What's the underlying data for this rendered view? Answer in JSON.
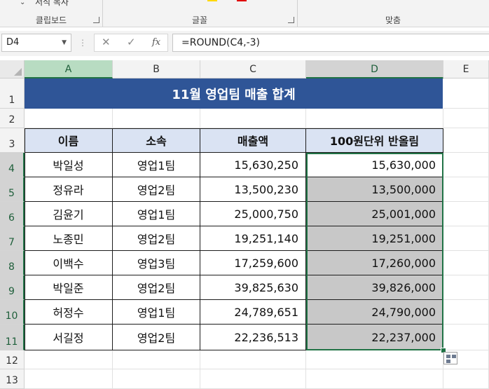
{
  "ribbon": {
    "clipboard_label": "클립보드",
    "copy_label": "서식 복사",
    "font_label": "글꼴",
    "align_label": "맞춤"
  },
  "formula_bar": {
    "name_box": "D4",
    "formula": "=ROUND(C4,-3)",
    "cancel_icon": "✕",
    "enter_icon": "✓",
    "fx_icon": "fx"
  },
  "columns": [
    "A",
    "B",
    "C",
    "D",
    "E"
  ],
  "rows": [
    "1",
    "2",
    "3",
    "4",
    "5",
    "6",
    "7",
    "8",
    "9",
    "10",
    "11",
    "12",
    "13"
  ],
  "sheet": {
    "title": "11월 영업팀 매출 합계",
    "headers": [
      "이름",
      "소속",
      "매출액",
      "100원단위 반올림"
    ],
    "data": [
      [
        "박일성",
        "영업1팀",
        "15,630,250",
        "15,630,000"
      ],
      [
        "정유라",
        "영업2팀",
        "13,500,230",
        "13,500,000"
      ],
      [
        "김윤기",
        "영업1팀",
        "25,000,750",
        "25,001,000"
      ],
      [
        "노종민",
        "영업2팀",
        "19,251,140",
        "19,251,000"
      ],
      [
        "이백수",
        "영업3팀",
        "17,259,600",
        "17,260,000"
      ],
      [
        "박일준",
        "영업2팀",
        "39,825,630",
        "39,826,000"
      ],
      [
        "허정수",
        "영업1팀",
        "24,789,651",
        "24,790,000"
      ],
      [
        "서길정",
        "영업2팀",
        "22,236,513",
        "22,237,000"
      ]
    ]
  },
  "colors": {
    "title_bg": "#2f5597",
    "header_bg": "#dae3f3",
    "selection_fill": "#c8c8c8",
    "selection_border": "#217346"
  }
}
